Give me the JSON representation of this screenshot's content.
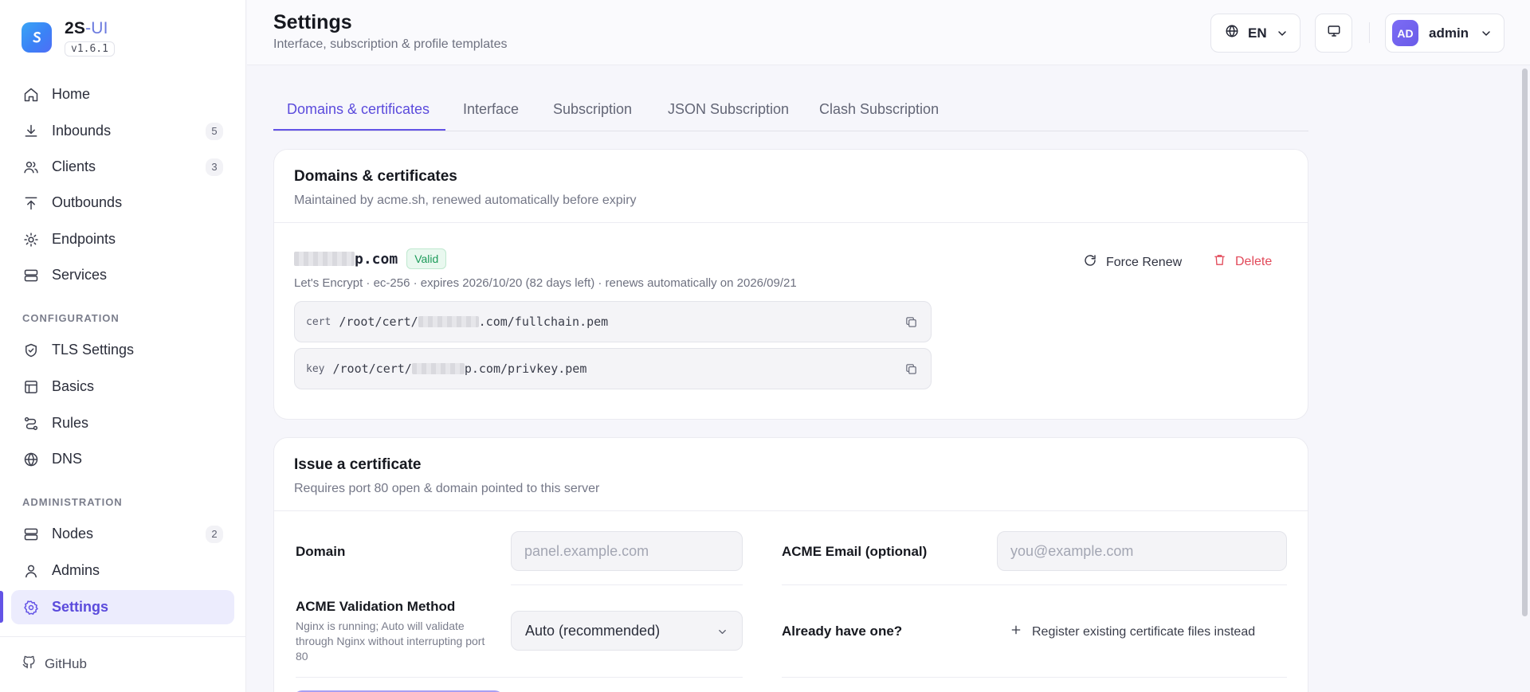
{
  "brand": {
    "name_main": "2S",
    "name_sep": "-",
    "name_accent": "UI",
    "version": "v1.6.1",
    "logo_icon": "swirl-logo-icon"
  },
  "sidebar": {
    "main": [
      {
        "label": "Home",
        "icon": "home-icon"
      },
      {
        "label": "Inbounds",
        "icon": "download-icon",
        "count": "5"
      },
      {
        "label": "Clients",
        "icon": "users-icon",
        "count": "3"
      },
      {
        "label": "Outbounds",
        "icon": "upload-icon"
      },
      {
        "label": "Endpoints",
        "icon": "sun-icon"
      },
      {
        "label": "Services",
        "icon": "server-icon"
      }
    ],
    "configuration_title": "CONFIGURATION",
    "configuration": [
      {
        "label": "TLS Settings",
        "icon": "shield-check-icon"
      },
      {
        "label": "Basics",
        "icon": "layout-icon"
      },
      {
        "label": "Rules",
        "icon": "route-icon"
      },
      {
        "label": "DNS",
        "icon": "globe-icon"
      }
    ],
    "administration_title": "ADMINISTRATION",
    "administration": [
      {
        "label": "Nodes",
        "icon": "server-icon",
        "count": "2"
      },
      {
        "label": "Admins",
        "icon": "user-icon"
      },
      {
        "label": "Settings",
        "icon": "gear-icon",
        "active": true
      }
    ],
    "github": "GitHub"
  },
  "header": {
    "title": "Settings",
    "subtitle": "Interface, subscription & profile templates",
    "lang": "EN",
    "avatar_initials": "AD",
    "user": "admin"
  },
  "tabs": [
    {
      "label": "Domains & certificates",
      "active": true
    },
    {
      "label": "Interface"
    },
    {
      "label": "Subscription"
    },
    {
      "label": "JSON Subscription"
    },
    {
      "label": "Clash Subscription"
    }
  ],
  "domains_card": {
    "title": "Domains & certificates",
    "subtitle": "Maintained by acme.sh, renewed automatically before expiry",
    "domain_suffix": "p.com",
    "status": "Valid",
    "meta": "Let's Encrypt · ec-256 · expires 2026/10/20 (82 days left) · renews automatically on 2026/09/21",
    "cert_tag": "cert",
    "cert_prefix": "/root/cert/",
    "cert_suffix": ".com/fullchain.pem",
    "key_tag": "key",
    "key_prefix": "/root/cert/",
    "key_suffix": "p.com/privkey.pem",
    "force_renew": "Force Renew",
    "delete": "Delete"
  },
  "issue_card": {
    "title": "Issue a certificate",
    "subtitle": "Requires port 80 open & domain pointed to this server",
    "domain_label": "Domain",
    "domain_placeholder": "panel.example.com",
    "email_label": "ACME Email (optional)",
    "email_placeholder": "you@example.com",
    "method_label": "ACME Validation Method",
    "method_hint": "Nginx is running; Auto will validate through Nginx without interrupting port 80",
    "method_value": "Auto (recommended)",
    "already_label": "Already have one?",
    "register_link": "Register existing certificate files instead"
  },
  "colors": {
    "accent": "#6353e6",
    "valid": "#1d9b5a",
    "danger": "#e24a5a"
  }
}
